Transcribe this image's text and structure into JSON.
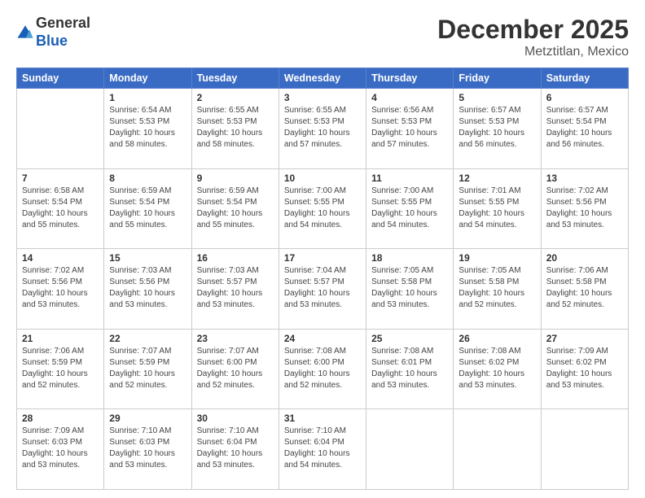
{
  "header": {
    "logo": {
      "line1": "General",
      "line2": "Blue"
    },
    "title": "December 2025",
    "subtitle": "Metztitlan, Mexico"
  },
  "weekdays": [
    "Sunday",
    "Monday",
    "Tuesday",
    "Wednesday",
    "Thursday",
    "Friday",
    "Saturday"
  ],
  "weeks": [
    [
      {
        "day": "",
        "info": ""
      },
      {
        "day": "1",
        "info": "Sunrise: 6:54 AM\nSunset: 5:53 PM\nDaylight: 10 hours\nand 58 minutes."
      },
      {
        "day": "2",
        "info": "Sunrise: 6:55 AM\nSunset: 5:53 PM\nDaylight: 10 hours\nand 58 minutes."
      },
      {
        "day": "3",
        "info": "Sunrise: 6:55 AM\nSunset: 5:53 PM\nDaylight: 10 hours\nand 57 minutes."
      },
      {
        "day": "4",
        "info": "Sunrise: 6:56 AM\nSunset: 5:53 PM\nDaylight: 10 hours\nand 57 minutes."
      },
      {
        "day": "5",
        "info": "Sunrise: 6:57 AM\nSunset: 5:53 PM\nDaylight: 10 hours\nand 56 minutes."
      },
      {
        "day": "6",
        "info": "Sunrise: 6:57 AM\nSunset: 5:54 PM\nDaylight: 10 hours\nand 56 minutes."
      }
    ],
    [
      {
        "day": "7",
        "info": "Sunrise: 6:58 AM\nSunset: 5:54 PM\nDaylight: 10 hours\nand 55 minutes."
      },
      {
        "day": "8",
        "info": "Sunrise: 6:59 AM\nSunset: 5:54 PM\nDaylight: 10 hours\nand 55 minutes."
      },
      {
        "day": "9",
        "info": "Sunrise: 6:59 AM\nSunset: 5:54 PM\nDaylight: 10 hours\nand 55 minutes."
      },
      {
        "day": "10",
        "info": "Sunrise: 7:00 AM\nSunset: 5:55 PM\nDaylight: 10 hours\nand 54 minutes."
      },
      {
        "day": "11",
        "info": "Sunrise: 7:00 AM\nSunset: 5:55 PM\nDaylight: 10 hours\nand 54 minutes."
      },
      {
        "day": "12",
        "info": "Sunrise: 7:01 AM\nSunset: 5:55 PM\nDaylight: 10 hours\nand 54 minutes."
      },
      {
        "day": "13",
        "info": "Sunrise: 7:02 AM\nSunset: 5:56 PM\nDaylight: 10 hours\nand 53 minutes."
      }
    ],
    [
      {
        "day": "14",
        "info": "Sunrise: 7:02 AM\nSunset: 5:56 PM\nDaylight: 10 hours\nand 53 minutes."
      },
      {
        "day": "15",
        "info": "Sunrise: 7:03 AM\nSunset: 5:56 PM\nDaylight: 10 hours\nand 53 minutes."
      },
      {
        "day": "16",
        "info": "Sunrise: 7:03 AM\nSunset: 5:57 PM\nDaylight: 10 hours\nand 53 minutes."
      },
      {
        "day": "17",
        "info": "Sunrise: 7:04 AM\nSunset: 5:57 PM\nDaylight: 10 hours\nand 53 minutes."
      },
      {
        "day": "18",
        "info": "Sunrise: 7:05 AM\nSunset: 5:58 PM\nDaylight: 10 hours\nand 53 minutes."
      },
      {
        "day": "19",
        "info": "Sunrise: 7:05 AM\nSunset: 5:58 PM\nDaylight: 10 hours\nand 52 minutes."
      },
      {
        "day": "20",
        "info": "Sunrise: 7:06 AM\nSunset: 5:58 PM\nDaylight: 10 hours\nand 52 minutes."
      }
    ],
    [
      {
        "day": "21",
        "info": "Sunrise: 7:06 AM\nSunset: 5:59 PM\nDaylight: 10 hours\nand 52 minutes."
      },
      {
        "day": "22",
        "info": "Sunrise: 7:07 AM\nSunset: 5:59 PM\nDaylight: 10 hours\nand 52 minutes."
      },
      {
        "day": "23",
        "info": "Sunrise: 7:07 AM\nSunset: 6:00 PM\nDaylight: 10 hours\nand 52 minutes."
      },
      {
        "day": "24",
        "info": "Sunrise: 7:08 AM\nSunset: 6:00 PM\nDaylight: 10 hours\nand 52 minutes."
      },
      {
        "day": "25",
        "info": "Sunrise: 7:08 AM\nSunset: 6:01 PM\nDaylight: 10 hours\nand 53 minutes."
      },
      {
        "day": "26",
        "info": "Sunrise: 7:08 AM\nSunset: 6:02 PM\nDaylight: 10 hours\nand 53 minutes."
      },
      {
        "day": "27",
        "info": "Sunrise: 7:09 AM\nSunset: 6:02 PM\nDaylight: 10 hours\nand 53 minutes."
      }
    ],
    [
      {
        "day": "28",
        "info": "Sunrise: 7:09 AM\nSunset: 6:03 PM\nDaylight: 10 hours\nand 53 minutes."
      },
      {
        "day": "29",
        "info": "Sunrise: 7:10 AM\nSunset: 6:03 PM\nDaylight: 10 hours\nand 53 minutes."
      },
      {
        "day": "30",
        "info": "Sunrise: 7:10 AM\nSunset: 6:04 PM\nDaylight: 10 hours\nand 53 minutes."
      },
      {
        "day": "31",
        "info": "Sunrise: 7:10 AM\nSunset: 6:04 PM\nDaylight: 10 hours\nand 54 minutes."
      },
      {
        "day": "",
        "info": ""
      },
      {
        "day": "",
        "info": ""
      },
      {
        "day": "",
        "info": ""
      }
    ]
  ]
}
